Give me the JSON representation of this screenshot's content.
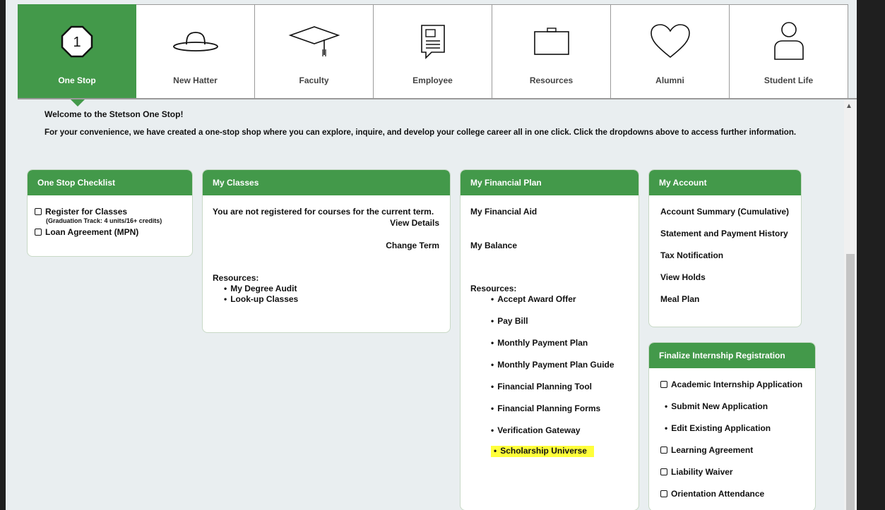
{
  "nav": {
    "items": [
      {
        "label": "One Stop",
        "icon": "octagon-number-icon",
        "icon_text": "1",
        "active": true
      },
      {
        "label": "New Hatter",
        "icon": "hat-icon"
      },
      {
        "label": "Faculty",
        "icon": "graduation-cap-icon"
      },
      {
        "label": "Employee",
        "icon": "document-icon"
      },
      {
        "label": "Resources",
        "icon": "briefcase-icon"
      },
      {
        "label": "Alumni",
        "icon": "heart-icon"
      },
      {
        "label": "Student Life",
        "icon": "person-icon"
      }
    ]
  },
  "welcome": {
    "title": "Welcome to the Stetson One Stop!",
    "text": "For your convenience, we have created a one-stop shop where you can explore, inquire, and develop your college career all in one click. Click the dropdowns above to access further information."
  },
  "checklist": {
    "title": "One Stop Checklist",
    "items": [
      {
        "label": "Register for Classes",
        "sub": "(Graduation Track: 4 units/16+ credits)"
      },
      {
        "label": "Loan Agreement (MPN)"
      }
    ]
  },
  "classes": {
    "title": "My Classes",
    "message": "You are not registered for courses for the current term.",
    "view_details": "View Details",
    "change_term": "Change Term",
    "resources_label": "Resources:",
    "resources": [
      "My Degree Audit",
      "Look-up Classes"
    ]
  },
  "financial": {
    "title": "My Financial Plan",
    "financial_aid": "My Financial Aid",
    "balance": "My Balance",
    "resources_label": "Resources:",
    "resources": [
      "Accept Award Offer",
      "Pay Bill",
      "Monthly Payment Plan",
      "Monthly Payment Plan Guide",
      "Financial Planning Tool",
      "Financial Planning Forms",
      "Verification Gateway",
      "Scholarship Universe"
    ],
    "highlight_color": "#ffff3a"
  },
  "account": {
    "title": "My Account",
    "links": [
      "Account Summary (Cumulative)",
      "Statement and Payment History",
      "Tax Notification",
      "View Holds",
      "Meal Plan"
    ]
  },
  "internship": {
    "title": "Finalize Internship Registration",
    "application_label": "Academic Internship Application",
    "application_links": [
      "Submit New Application",
      "Edit Existing Application"
    ],
    "items": [
      "Learning Agreement",
      "Liability Waiver",
      "Orientation Attendance"
    ]
  },
  "colors": {
    "brand_green": "#43994a",
    "background": "#e9eef0"
  }
}
